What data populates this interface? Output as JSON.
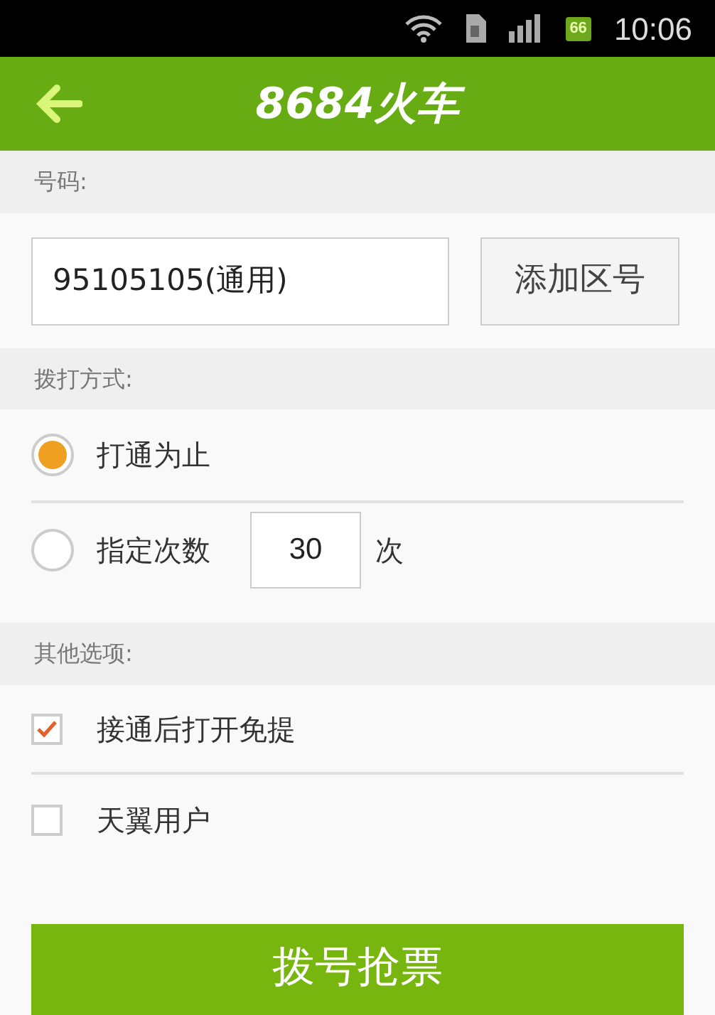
{
  "status_bar": {
    "battery": "66",
    "time": "10:06"
  },
  "header": {
    "title": "8684火车"
  },
  "number_section": {
    "label": "号码:",
    "field": {
      "value": "95105105(通用)"
    },
    "button": "添加区号"
  },
  "dial_section": {
    "label": "拨打方式:",
    "options": [
      {
        "kind": "plain",
        "label": "打通为止",
        "selected": true
      },
      {
        "kind": "count",
        "label": "指定次数",
        "selected": false,
        "count": "30",
        "unit": "次"
      }
    ]
  },
  "other_section": {
    "label": "其他选项:",
    "options": [
      {
        "label": "接通后打开免提",
        "checked": true
      },
      {
        "label": "天翼用户",
        "checked": false
      }
    ]
  },
  "action_button": "拨号抢票"
}
